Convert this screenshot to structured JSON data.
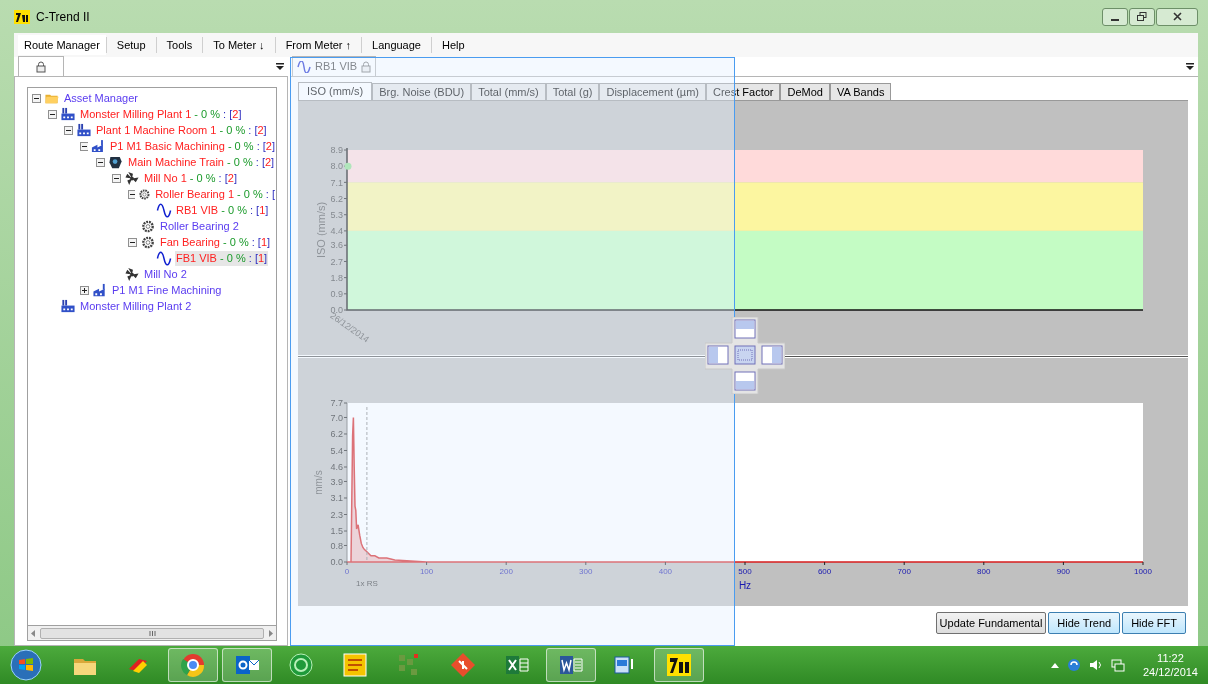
{
  "window": {
    "title": "C-Trend II"
  },
  "menu": [
    {
      "label": "Route Manager",
      "selected": true
    },
    {
      "label": "Setup",
      "selected": false
    },
    {
      "label": "Tools",
      "selected": false
    },
    {
      "label": "To Meter ↓",
      "selected": false
    },
    {
      "label": "From Meter ↑",
      "selected": false
    },
    {
      "label": "Language",
      "selected": false
    },
    {
      "label": "Help",
      "selected": false
    }
  ],
  "tree": [
    {
      "kind": "folder",
      "label": "Asset Manager",
      "alarm": false,
      "expanded": true,
      "selected": false,
      "children": [
        {
          "kind": "plant",
          "label": "Monster Milling Plant 1",
          "stats": "- 0 % : [2]",
          "alarm": true,
          "expanded": true,
          "selected": false,
          "children": [
            {
              "kind": "plant",
              "label": "Plant 1 Machine Room 1",
              "stats": "- 0 % : [2]",
              "alarm": true,
              "expanded": true,
              "selected": false,
              "children": [
                {
                  "kind": "machining",
                  "label": "P1 M1 Basic Machining ",
                  "stats": "- 0 % : [2]",
                  "alarm": true,
                  "expanded": true,
                  "selected": false,
                  "children": [
                    {
                      "kind": "train",
                      "label": "Main Machine Train ",
                      "stats": "- 0 % : [2]",
                      "alarm": true,
                      "expanded": true,
                      "selected": false,
                      "children": [
                        {
                          "kind": "fan",
                          "label": "Mill No 1",
                          "stats": "- 0 % : [2]",
                          "alarm": true,
                          "expanded": true,
                          "selected": false,
                          "children": [
                            {
                              "kind": "bearing",
                              "label": "Roller Bearing 1",
                              "stats": "- 0 % : [",
                              "alarm": true,
                              "expanded": true,
                              "selected": false,
                              "children": [
                                {
                                  "kind": "wave",
                                  "label": "RB1 VIB",
                                  "stats": "- 0 % : [1]",
                                  "alarm": true,
                                  "selected": false
                                }
                              ]
                            },
                            {
                              "kind": "bearing",
                              "label": "Roller Bearing 2",
                              "alarm": false,
                              "selected": false
                            },
                            {
                              "kind": "bearing",
                              "label": "Fan Bearing",
                              "stats": "- 0 % : [1]",
                              "alarm": true,
                              "expanded": true,
                              "selected": false,
                              "children": [
                                {
                                  "kind": "wave",
                                  "label": "FB1 VIB",
                                  "stats": "- 0 % : [1]",
                                  "alarm": true,
                                  "selected": true
                                }
                              ]
                            }
                          ]
                        },
                        {
                          "kind": "fan",
                          "label": "Mill No 2",
                          "alarm": false,
                          "selected": false
                        }
                      ]
                    }
                  ]
                },
                {
                  "kind": "machining",
                  "label": "P1 M1 Fine Machining",
                  "alarm": false,
                  "expanded": false,
                  "selected": false
                }
              ]
            }
          ]
        },
        {
          "kind": "plant",
          "label": "Monster Milling Plant 2",
          "alarm": false,
          "selected": false
        }
      ]
    }
  ],
  "document_tab": {
    "label": "RB1 VIB"
  },
  "tabs": [
    {
      "label": "ISO (mm/s)",
      "selected": true
    },
    {
      "label": "Brg. Noise (BDU)",
      "selected": false
    },
    {
      "label": "Total (mm/s)",
      "selected": false
    },
    {
      "label": "Total (g)",
      "selected": false
    },
    {
      "label": "Displacement (µm)",
      "selected": false
    },
    {
      "label": "Crest Factor",
      "selected": false
    },
    {
      "label": "DeMod",
      "selected": false
    },
    {
      "label": "VA Bands",
      "selected": false
    }
  ],
  "trend": {
    "chart_data": {
      "type": "scatter",
      "ylabel": "ISO (mm/s)",
      "x": [
        "26/12/2014"
      ],
      "series": [
        {
          "color": "#8ee08e",
          "values": [
            8.0
          ]
        }
      ],
      "ylim": [
        0,
        8.9
      ],
      "yticks": [
        {
          "value": 0,
          "label": "0.0"
        },
        0.9,
        1.8,
        2.7,
        3.6,
        4.4,
        5.3,
        6.2,
        7.1,
        {
          "value": 8,
          "label": "8.0"
        },
        8.9
      ],
      "bands": [
        {
          "axis": "y",
          "from": 7.1,
          "to": 8.9,
          "color": "#ffdada"
        },
        {
          "axis": "y",
          "from": 4.4,
          "to": 7.1,
          "color": "#fcf6a0"
        },
        {
          "axis": "y",
          "from": 0,
          "to": 4.4,
          "color": "#c4fcc4"
        }
      ]
    }
  },
  "spectrum": {
    "chart_data": {
      "type": "area",
      "xlabel": "Hz",
      "ylabel": "mm/s",
      "x": [
        0,
        5,
        7,
        8,
        9,
        10,
        11,
        12,
        14,
        16,
        18,
        20,
        22,
        25,
        30,
        35,
        40,
        50,
        60,
        80,
        100,
        1000
      ],
      "series": [
        {
          "color": "#d81e1e",
          "values": [
            0,
            0,
            6.1,
            7.0,
            4.6,
            2.7,
            2.5,
            1.6,
            1.8,
            1.3,
            0.9,
            0.7,
            0.6,
            0.5,
            0.3,
            0.3,
            0.2,
            0.2,
            0.1,
            0.05,
            0,
            0
          ]
        }
      ],
      "xlim": [
        0,
        1000
      ],
      "ylim": [
        0,
        7.7
      ],
      "xticks": [
        0,
        100,
        200,
        300,
        400,
        500,
        600,
        700,
        800,
        900,
        1000
      ],
      "yticks": [
        {
          "value": 0,
          "label": "0.0"
        },
        0.8,
        1.5,
        2.3,
        3.1,
        3.9,
        4.6,
        5.4,
        6.2,
        {
          "value": 7,
          "label": "7.0"
        },
        7.7
      ],
      "ref_lines": [
        {
          "axis": "x",
          "value": 25,
          "label": "1x RS"
        }
      ]
    }
  },
  "buttons": [
    {
      "label": "Update Fundamental",
      "selected": false
    },
    {
      "label": "Hide Trend",
      "selected": true
    },
    {
      "label": "Hide FFT",
      "selected": true
    }
  ],
  "taskbar": {
    "apps": [
      {
        "kind": "folder",
        "running": false
      },
      {
        "kind": "tool",
        "running": false
      },
      {
        "kind": "browser",
        "running": true
      },
      {
        "kind": "mail",
        "running": true
      },
      {
        "kind": "disc",
        "running": false
      },
      {
        "kind": "yellow",
        "running": false
      },
      {
        "kind": "tiles",
        "running": false
      },
      {
        "kind": "diamond",
        "running": false
      },
      {
        "kind": "sheet",
        "running": false
      },
      {
        "kind": "doc",
        "running": true
      },
      {
        "kind": "device",
        "running": false
      },
      {
        "kind": "logo",
        "running": true
      }
    ],
    "time": "11:22",
    "date": "24/12/2014"
  }
}
